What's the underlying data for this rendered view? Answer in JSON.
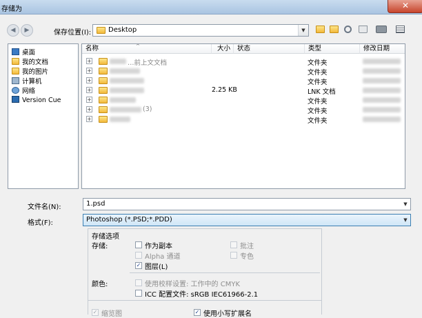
{
  "window": {
    "title": "存储为",
    "close_symbol": "✕"
  },
  "nav": {
    "back_symbol": "◀",
    "forward_symbol": "▶"
  },
  "location": {
    "label": "保存位置(I):",
    "value": "Desktop",
    "arrow": "▼"
  },
  "sidebar": {
    "items": [
      {
        "label": "桌面",
        "icon": "desktop-icon"
      },
      {
        "label": "我的文档",
        "icon": "documents-icon"
      },
      {
        "label": "我的图片",
        "icon": "pictures-icon"
      },
      {
        "label": "计算机",
        "icon": "computer-icon"
      },
      {
        "label": "网络",
        "icon": "network-icon"
      },
      {
        "label": "Version Cue",
        "icon": "version-cue-icon"
      }
    ]
  },
  "filelist": {
    "columns": [
      "名称",
      "大小",
      "状态",
      "类型",
      "修改日期"
    ],
    "rows": [
      {
        "size": "",
        "type": "文件夹"
      },
      {
        "size": "",
        "type": "文件夹"
      },
      {
        "size": "",
        "type": "文件夹"
      },
      {
        "size": "2.25 KB",
        "type": "LNK 文档"
      },
      {
        "size": "",
        "type": "文件夹"
      },
      {
        "size": "",
        "type": "文件夹"
      },
      {
        "size": "",
        "type": "文件夹"
      }
    ],
    "partial_names": {
      "row1": "…前上文文档",
      "row6": "(3)"
    }
  },
  "filename": {
    "label": "文件名(N):",
    "value": "1.psd",
    "arrow": "▼"
  },
  "format": {
    "label": "格式(F):",
    "value": "Photoshop (*.PSD;*.PDD)",
    "arrow": "▼"
  },
  "options": {
    "title": "存储选项",
    "save_label": "存储:",
    "as_copy": "作为副本",
    "annotations": "批注",
    "alpha": "Alpha 通道",
    "spot": "专色",
    "layers": "图层(L)",
    "color_label": "颜色:",
    "proof": "使用校样设置: 工作中的 CMYK",
    "icc": "ICC 配置文件: sRGB IEC61966-2.1",
    "thumbnail": "缩览图",
    "lowercase_ext": "使用小写扩展名",
    "check": "✓"
  }
}
